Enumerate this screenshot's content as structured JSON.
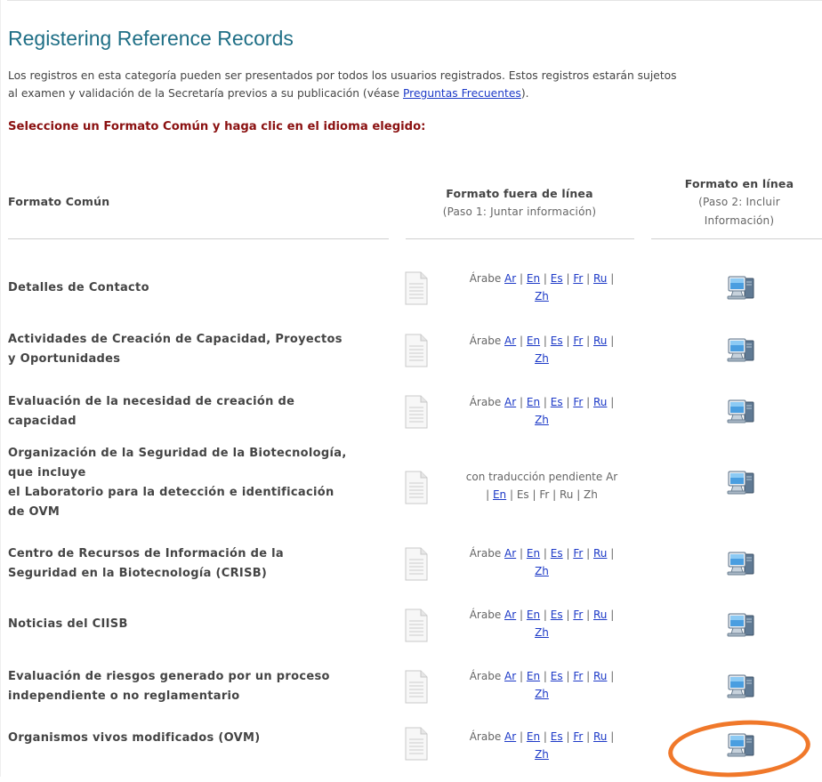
{
  "page": {
    "title": "Registering Reference Records",
    "intro_line1": "Los registros en esta categoría pueden ser presentados por todos los usuarios registrados. Estos registros estarán sujetos",
    "intro_line2_start": "al examen y validación de la Secretaría previos a su publicación (véase ",
    "faq_link": "Preguntas Frecuentes",
    "intro_line2_end": ").",
    "instruction": "Seleccione un Formato Común y haga clic en el idioma elegido:"
  },
  "table": {
    "headers": {
      "common": "Formato Común",
      "offline": "Formato fuera de línea",
      "offline_sub": "(Paso 1: Juntar información)",
      "online": "Formato en línea",
      "online_sub_1": "(Paso 2: Incluir",
      "online_sub_2": "Información)"
    },
    "sep": "|",
    "standard_prefix": "Árabe",
    "standard_langs": {
      "ar": "Ar",
      "en": "En",
      "es": "Es",
      "fr": "Fr",
      "ru": "Ru",
      "zh": "Zh"
    },
    "pending_prefix": "con traducción pendiente Ar",
    "pending_en": "En",
    "pending_rest": "| Es | Fr | Ru | Zh",
    "rows": [
      {
        "label_lines": [
          "Detalles de Contacto"
        ]
      },
      {
        "label_lines": [
          "Actividades de Creación de Capacidad, Proyectos",
          "y Oportunidades"
        ]
      },
      {
        "label_lines": [
          "Evaluación de la necesidad de creación de",
          "capacidad"
        ]
      },
      {
        "label_lines": [
          "Organización de la Seguridad de la Biotecnología,",
          "que incluye",
          "el Laboratorio para la detección e identificación",
          "de OVM"
        ]
      },
      {
        "label_lines": [
          "Centro de Recursos de Información de la",
          "Seguridad en la Biotecnología (CRISB)"
        ]
      },
      {
        "label_lines": [
          "Noticias del CIISB"
        ]
      },
      {
        "label_lines": [
          "Evaluación de riesgos generado por un proceso",
          "independiente o no reglamentario"
        ]
      },
      {
        "label_lines": [
          "Organismos vivos modificados (OVM)"
        ]
      }
    ]
  },
  "colors": {
    "title": "#1f6f86",
    "instruction": "#8a1010",
    "link": "#1c39c7",
    "highlight": "#f0782a"
  },
  "icons": {
    "offline": "document-icon",
    "online": "computer-icon"
  }
}
